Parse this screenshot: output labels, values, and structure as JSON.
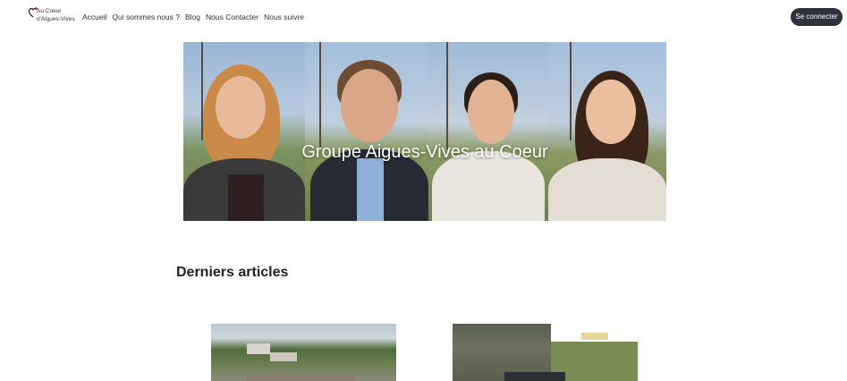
{
  "brand": {
    "logo_line1": "Au  Coeur",
    "logo_line2": "d'Aigues-Vives"
  },
  "nav": {
    "items": [
      {
        "label": "Accueil"
      },
      {
        "label": "Qui sommes nous ?"
      },
      {
        "label": "Blog"
      },
      {
        "label": "Nous Contacter"
      },
      {
        "label": "Nous suivre"
      }
    ]
  },
  "header": {
    "login_label": "Se connecter"
  },
  "hero": {
    "title": "Groupe Aigues-Vives au Coeur"
  },
  "articles": {
    "section_title": "Derniers articles"
  },
  "colors": {
    "button_bg": "#2e323a",
    "text": "#222222"
  }
}
